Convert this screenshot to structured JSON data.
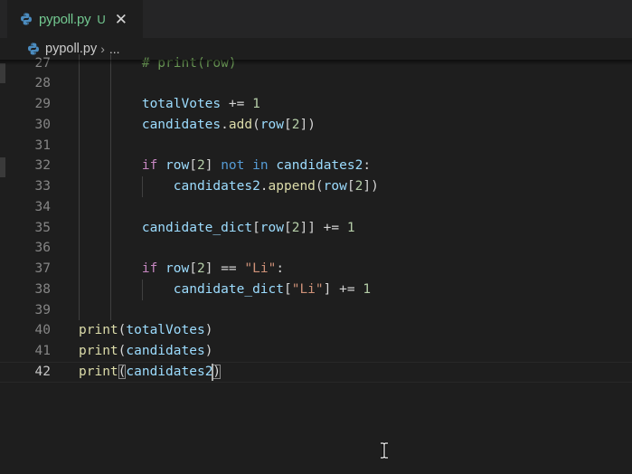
{
  "tab": {
    "filename": "pypoll.py",
    "status": "U",
    "close_glyph": "✕",
    "file_icon": "python-icon"
  },
  "breadcrumb": {
    "file": "pypoll.py",
    "separator": "›",
    "more": "..."
  },
  "colors": {
    "editor_bg": "#1e1e1e",
    "tab_untracked": "#73c991",
    "keyword": "#c586c0",
    "variable": "#9cdcfe",
    "function": "#dcdcaa",
    "number": "#b5cea8",
    "string": "#ce9178",
    "comment": "#6a9955"
  },
  "editor": {
    "current_line": "42",
    "lines": [
      {
        "n": "27",
        "code": "        # print(row)"
      },
      {
        "n": "28",
        "code": ""
      },
      {
        "n": "29",
        "code": "        totalVotes += 1"
      },
      {
        "n": "30",
        "code": "        candidates.add(row[2])"
      },
      {
        "n": "31",
        "code": ""
      },
      {
        "n": "32",
        "code": "        if row[2] not in candidates2:"
      },
      {
        "n": "33",
        "code": "            candidates2.append(row[2])"
      },
      {
        "n": "34",
        "code": ""
      },
      {
        "n": "35",
        "code": "        candidate_dict[row[2]] += 1"
      },
      {
        "n": "36",
        "code": ""
      },
      {
        "n": "37",
        "code": "        if row[2] == \"Li\":"
      },
      {
        "n": "38",
        "code": "            candidate_dict[\"Li\"] += 1"
      },
      {
        "n": "39",
        "code": ""
      },
      {
        "n": "40",
        "code": "print(totalVotes)"
      },
      {
        "n": "41",
        "code": "print(candidates)"
      },
      {
        "n": "42",
        "code": "print(candidates2)"
      }
    ]
  }
}
